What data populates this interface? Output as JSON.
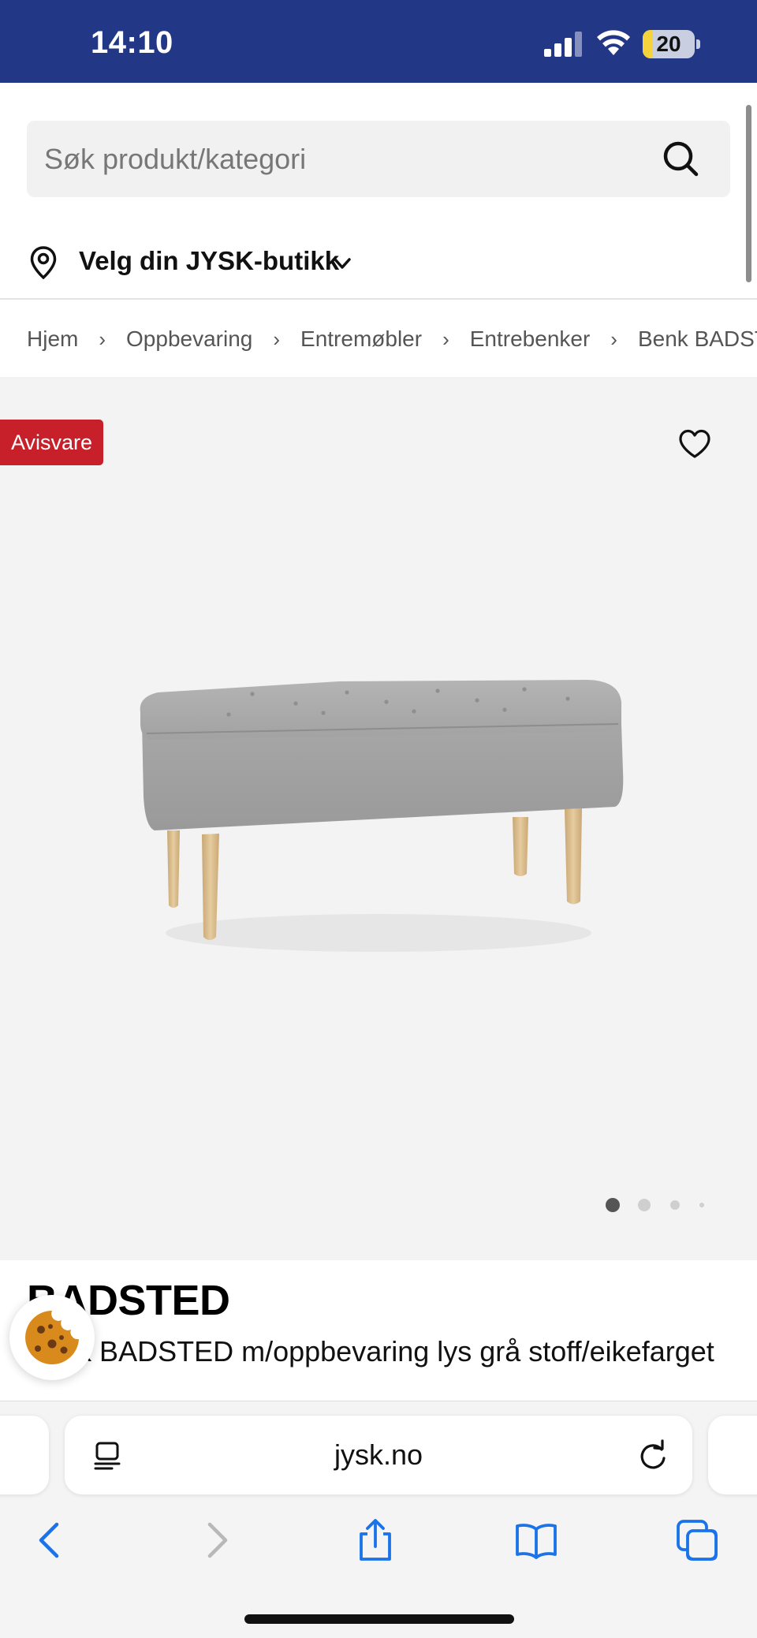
{
  "status_bar": {
    "time": "14:10",
    "battery_percent": "20",
    "battery_level": 0.2,
    "background_color": "#223886"
  },
  "search": {
    "placeholder": "Søk produkt/kategori",
    "icon": "search-icon"
  },
  "store": {
    "label": "Velg din JYSK-butikk",
    "icon": "map-pin-icon"
  },
  "breadcrumb": [
    "Hjem",
    "Oppbevaring",
    "Entremøbler",
    "Entrebenker",
    "Benk BADST"
  ],
  "gallery": {
    "badge": "Avisvare",
    "badge_color": "#c8202a",
    "image_count": 4,
    "active_image": 1
  },
  "product": {
    "title": "BADSTED",
    "subtitle": "Benk BADSTED m/oppbevaring lys grå stoff/eikefar­get"
  },
  "browser": {
    "url": "jysk.no",
    "accent_color": "#1a73e8"
  }
}
